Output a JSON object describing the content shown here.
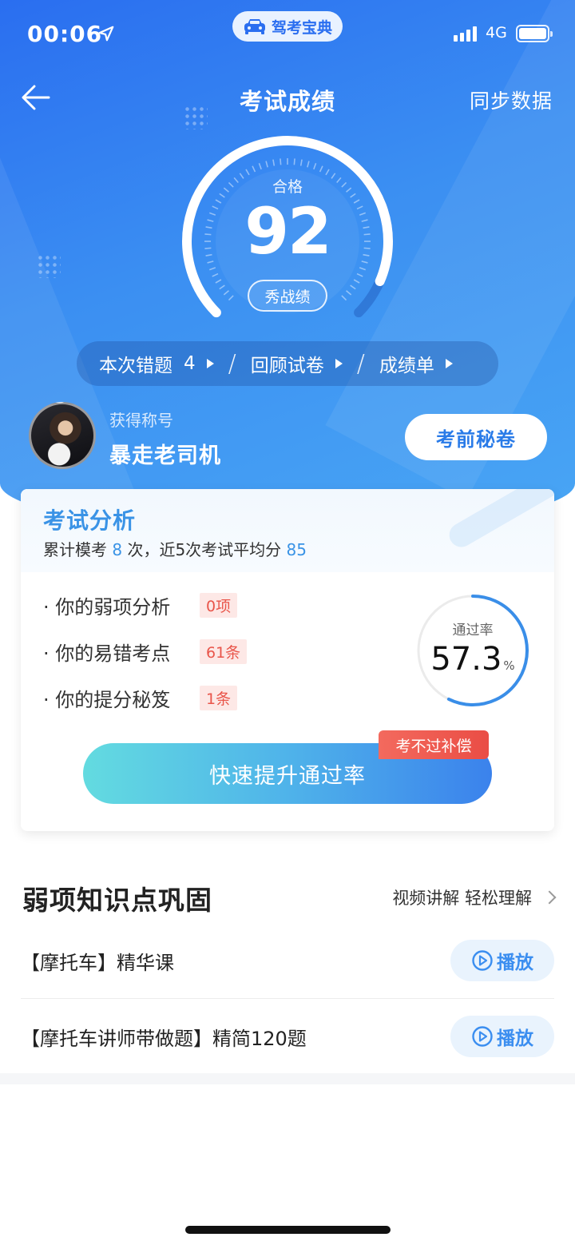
{
  "status_bar": {
    "time": "00:06",
    "app_pill": "驾考宝典",
    "network": "4G"
  },
  "nav": {
    "title": "考试成绩",
    "sync": "同步数据"
  },
  "score": {
    "result": "合格",
    "value": "92",
    "value_fraction": 0.92,
    "show_button": "秀战绩"
  },
  "links": {
    "wrong_label": "本次错题",
    "wrong_count": "4",
    "separator": "/",
    "review": "回顾试卷",
    "report": "成绩单"
  },
  "title_row": {
    "sub": "获得称号",
    "name": "暴走老司机",
    "secret_button": "考前秘卷"
  },
  "analysis": {
    "title": "考试分析",
    "summary_prefix": "累计模考",
    "exam_count": "8",
    "summary_mid": "次，近5次考试平均分",
    "avg_score": "85",
    "items": [
      {
        "label": "· 你的弱项分析",
        "tag": "0项"
      },
      {
        "label": "· 你的易错考点",
        "tag": "61条"
      },
      {
        "label": "· 你的提分秘笈",
        "tag": "1条"
      }
    ],
    "pass_rate_label": "通过率",
    "pass_rate": "57.3",
    "pass_rate_unit": "%",
    "pass_rate_fraction": 0.573,
    "boost_button": "快速提升通过率",
    "compensation_badge": "考不过补偿"
  },
  "weak": {
    "title": "弱项知识点巩固",
    "more": "视频讲解 轻松理解",
    "courses": [
      {
        "name": "【摩托车】精华课",
        "play": "播放"
      },
      {
        "name": "【摩托车讲师带做题】精简120题",
        "play": "播放"
      }
    ]
  },
  "colors": {
    "brand_blue": "#2a6ef0",
    "accent_blue": "#3a93e6",
    "tag_red": "#e9554a",
    "badge_red": "#ea4d45"
  },
  "icons": [
    "location-arrow-icon",
    "car-icon",
    "back-arrow-icon",
    "play-circle-icon",
    "chevron-right-icon"
  ]
}
